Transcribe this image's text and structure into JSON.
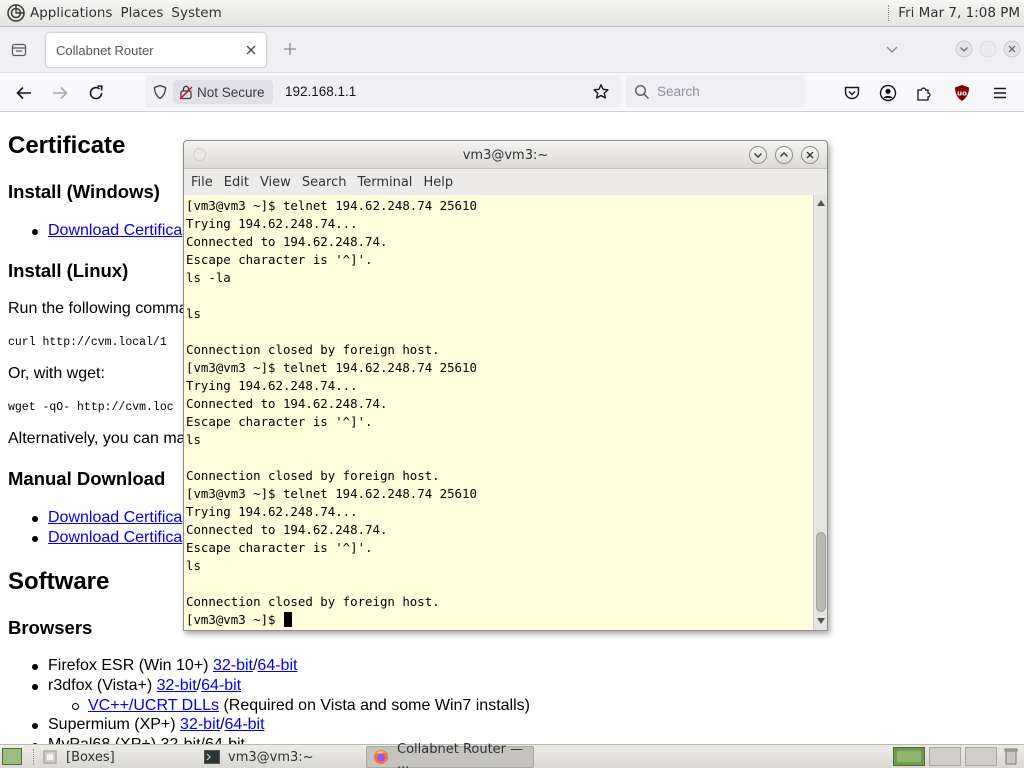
{
  "top_panel": {
    "menus": [
      "Applications",
      "Places",
      "System"
    ],
    "clock": "Fri Mar  7,  1:08 PM"
  },
  "browser": {
    "tab_title": "Collabnet Router",
    "security_label": "Not Secure",
    "url": "192.168.1.1",
    "search_placeholder": "Search"
  },
  "page": {
    "cert_heading": "Certificate",
    "install_windows": "Install (Windows)",
    "download_cert_link": "Download Certifica",
    "install_linux": "Install (Linux)",
    "run_text": "Run the following comma",
    "curl_cmd": "curl http://cvm.local/1",
    "or_wget": "Or, with wget:",
    "wget_cmd": "wget -qO- http://cvm.loc",
    "alternatively": "Alternatively, you can ma",
    "manual_download": "Manual Download",
    "manual_link_1": "Download Certifica",
    "manual_link_2": "Download Certifica",
    "software": "Software",
    "browsers": "Browsers",
    "firefox_esr": "Firefox ESR (Win 10+) ",
    "r3dfox": "r3dfox (Vista+) ",
    "link_32": "32-bit",
    "slash": "/",
    "link_64": "64-bit",
    "vcpp_link": "VC++/UCRT DLLs",
    "vcpp_note": " (Required on Vista and some Win7 installs)",
    "supermium": "Supermium (XP+) ",
    "mypal_partial": "MyPal68 (XP+) 32-bit/64-bit"
  },
  "terminal": {
    "title": "vm3@vm3:~",
    "menus": [
      "File",
      "Edit",
      "View",
      "Search",
      "Terminal",
      "Help"
    ],
    "lines": [
      "[vm3@vm3 ~]$ telnet 194.62.248.74 25610",
      "Trying 194.62.248.74...",
      "Connected to 194.62.248.74.",
      "Escape character is '^]'.",
      "ls -la",
      "",
      "ls",
      "",
      "Connection closed by foreign host.",
      "[vm3@vm3 ~]$ telnet 194.62.248.74 25610",
      "Trying 194.62.248.74...",
      "Connected to 194.62.248.74.",
      "Escape character is '^]'.",
      "ls",
      "",
      "Connection closed by foreign host.",
      "[vm3@vm3 ~]$ telnet 194.62.248.74 25610",
      "Trying 194.62.248.74...",
      "Connected to 194.62.248.74.",
      "Escape character is '^]'.",
      "ls",
      "",
      "Connection closed by foreign host."
    ],
    "prompt": "[vm3@vm3 ~]$ "
  },
  "taskbar": {
    "items": [
      "[Boxes]",
      "vm3@vm3:~",
      "Collabnet Router — ..."
    ]
  }
}
